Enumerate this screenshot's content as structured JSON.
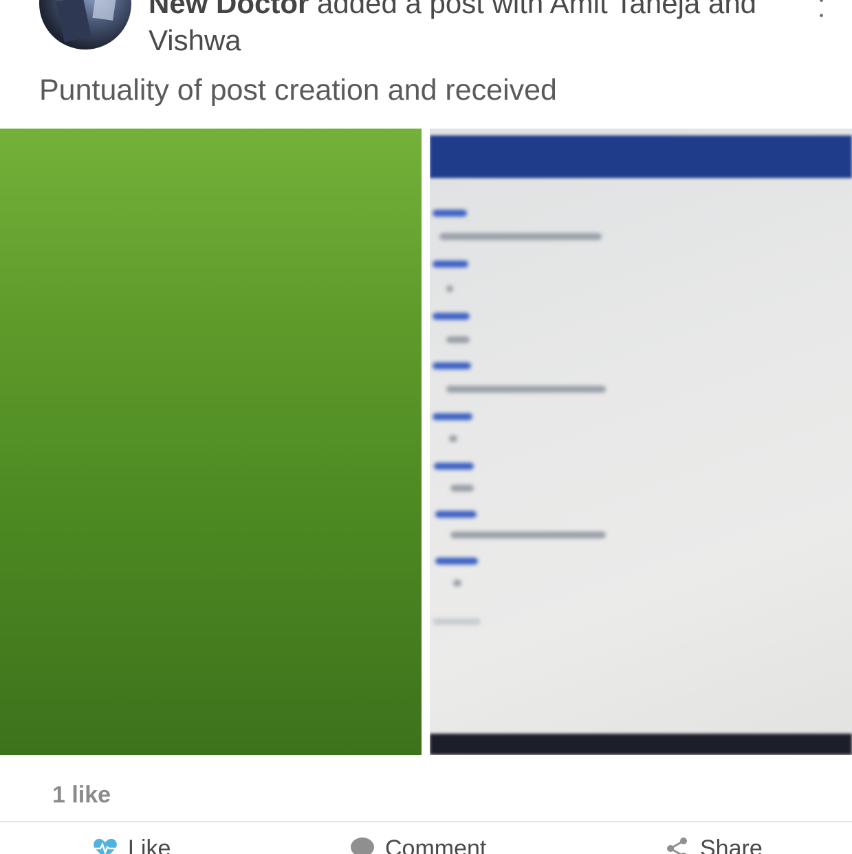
{
  "post": {
    "author": "New Doctor",
    "action_text": " added a post with Amit Taneja and Vishwa",
    "body": "Puntuality of post creation and received",
    "likes_count": "1 like"
  },
  "actions": {
    "like_label": "Like",
    "comment_label": "Comment",
    "share_label": "Share"
  },
  "icons": {
    "more": "more-vertical-icon",
    "like": "heart-pulse-icon",
    "comment": "comment-bubble-icon",
    "share": "share-icon"
  },
  "colors": {
    "like_icon": "#4fb3e0",
    "text": "#4a4a4a",
    "muted": "#8a8a8a",
    "image_green": "#5f9b2b"
  }
}
